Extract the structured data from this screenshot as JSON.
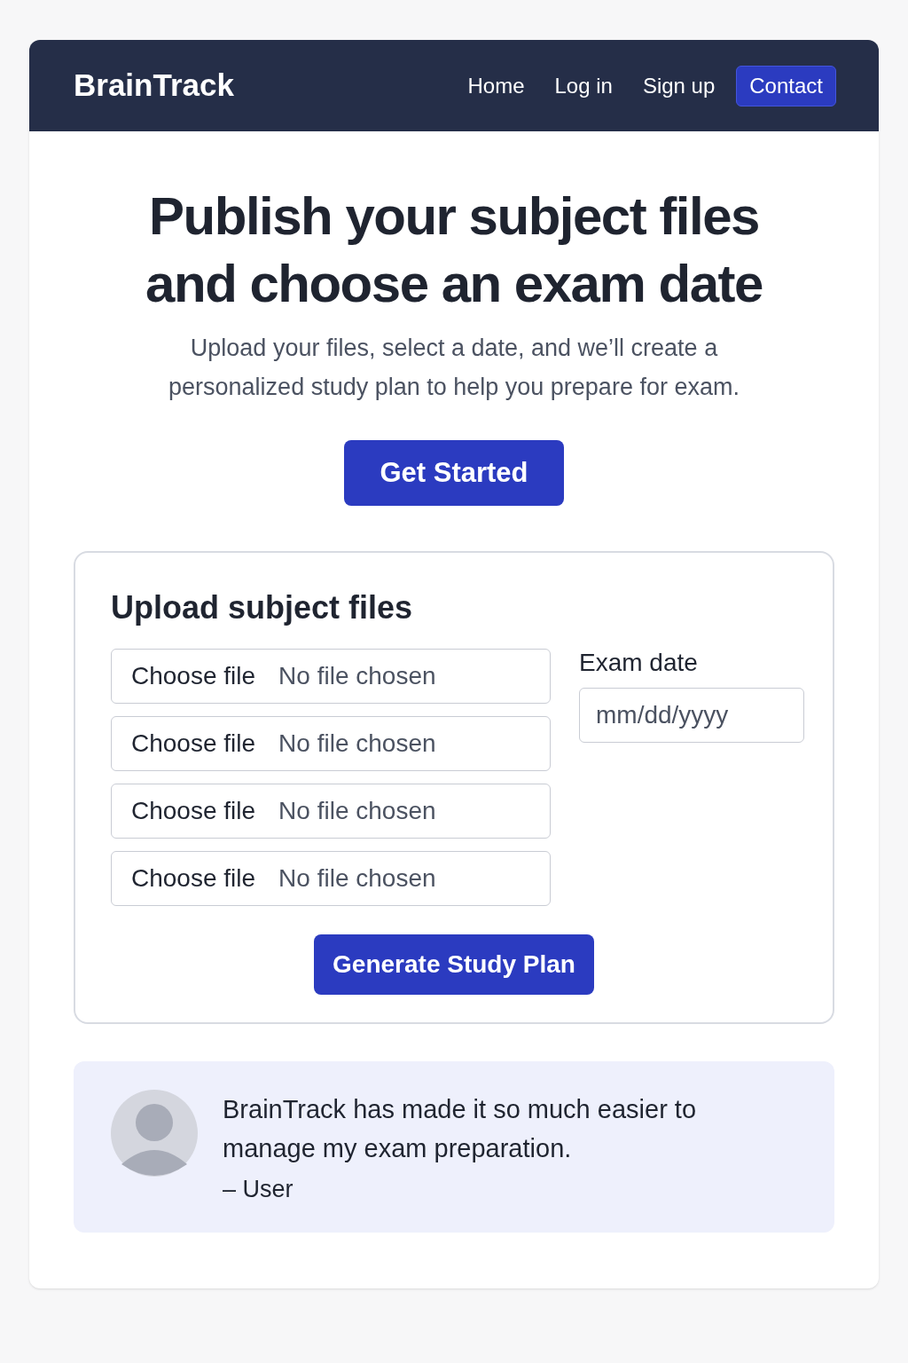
{
  "header": {
    "logo": "BrainTrack",
    "nav": [
      {
        "label": "Home",
        "kind": "link"
      },
      {
        "label": "Log in",
        "kind": "link"
      },
      {
        "label": "Sign up",
        "kind": "link"
      },
      {
        "label": "Contact",
        "kind": "button"
      }
    ]
  },
  "hero": {
    "title_lines": [
      "Publish your subject files",
      "and choose an exam date"
    ],
    "subtitle": "Upload your files, select a date, and we’ll create a personalized study plan to help you prepare for exam.",
    "button": "Get Started"
  },
  "upload": {
    "title": "Upload subject files",
    "files": [
      {
        "button": "Choose file",
        "status": "No file chosen"
      },
      {
        "button": "Choose file",
        "status": "No file chosen"
      },
      {
        "button": "Choose file",
        "status": "No file chosen"
      },
      {
        "button": "Choose file",
        "status": "No file chosen"
      }
    ],
    "date_label": "Exam date",
    "date_placeholder": "mm/dd/yyyy",
    "button": "Generate Study Plan"
  },
  "testimonial": {
    "quote": "BrainTrack has made it so much easier to manage my exam preparation.",
    "author": "– User"
  }
}
